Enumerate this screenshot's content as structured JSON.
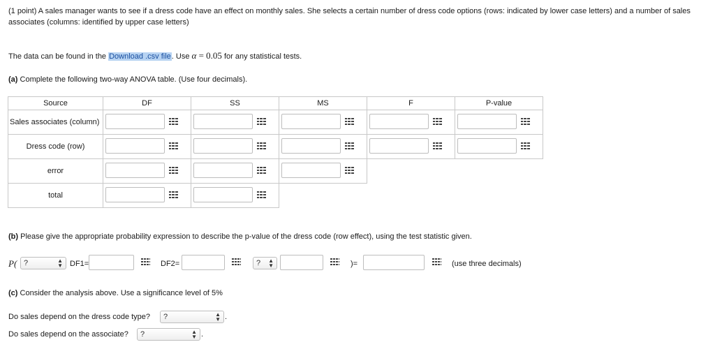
{
  "intro": {
    "text": "(1 point) A sales manager wants to see if a dress code have an effect on monthly sales. She selects a certain number of dress code options (rows: indicated by lower case letters) and a number of sales associates (columns: identified by upper case letters)"
  },
  "data_line": {
    "prefix": "The data can be found in the ",
    "link": "Download .csv file",
    "middle": ". Use ",
    "alpha_symbol": "α",
    "equals": " = 0.05",
    "suffix": " for any statistical tests."
  },
  "part_a": {
    "label": "(a)",
    "text": " Complete the following two-way ANOVA table. (Use four decimals).",
    "headers": [
      "Source",
      "DF",
      "SS",
      "MS",
      "F",
      "P-value"
    ],
    "rows": [
      {
        "source": "Sales associates (column)"
      },
      {
        "source": "Dress code (row)"
      },
      {
        "source": "error"
      },
      {
        "source": "total"
      }
    ]
  },
  "part_b": {
    "label": "(b)",
    "text": " Please give the appropriate probability expression to describe the p-value of the dress code (row effect), using the test statistic given.",
    "p_open": "P(",
    "dist_select": "?",
    "df1_label": "DF1=",
    "df2_label": "DF2=",
    "compare_select": "?",
    "close_eq": ")=",
    "note": "(use three decimals)"
  },
  "part_c": {
    "label": "(c)",
    "text": " Consider the analysis above. Use a significance level of 5%",
    "q1": "Do sales depend on the dress code type?",
    "q1_select": "?",
    "q2": "Do sales depend on the associate?",
    "q2_select": "?"
  }
}
